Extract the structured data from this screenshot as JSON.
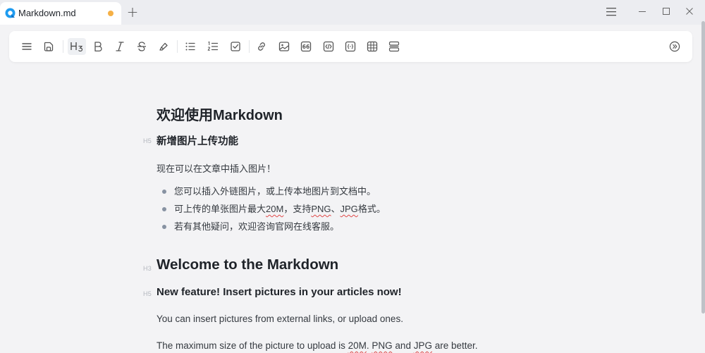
{
  "tab": {
    "title": "Markdown.md",
    "unsaved_color": "#f5b046"
  },
  "toolbar": {
    "buttons": [
      {
        "name": "menu-icon",
        "label": "menu"
      },
      {
        "name": "save-icon",
        "label": "save"
      },
      {
        "name": "heading-icon",
        "label": "H3",
        "active": true
      },
      {
        "name": "bold-icon",
        "label": "B"
      },
      {
        "name": "italic-icon",
        "label": "I"
      },
      {
        "name": "strikethrough-icon",
        "label": "S"
      },
      {
        "name": "highlight-icon",
        "label": "highlight"
      },
      {
        "name": "bullet-list-icon",
        "label": "bullet list"
      },
      {
        "name": "ordered-list-icon",
        "label": "ordered list"
      },
      {
        "name": "task-list-icon",
        "label": "task list"
      },
      {
        "name": "link-icon",
        "label": "link"
      },
      {
        "name": "image-icon",
        "label": "image"
      },
      {
        "name": "quote-icon",
        "label": "66"
      },
      {
        "name": "code-icon",
        "label": "code"
      },
      {
        "name": "code-block-icon",
        "label": "code block"
      },
      {
        "name": "table-icon",
        "label": "table"
      },
      {
        "name": "divider-icon",
        "label": "divider"
      },
      {
        "name": "expand-icon",
        "label": "more"
      }
    ]
  },
  "document": {
    "h1_cn": "欢迎使用Markdown",
    "h5_cn": "新增图片上传功能",
    "h5_cn_tag": "H5",
    "p_cn": "现在可以在文章中插入图片！",
    "bullets": [
      {
        "parts": [
          "您可以插入外链图片，或上传本地图片到文档中。"
        ]
      },
      {
        "parts": [
          "可上传的单张图片最大",
          "20M",
          "，支持",
          "PNG",
          "、",
          "JPG",
          "格式。"
        ]
      },
      {
        "parts": [
          "若有其他疑问，欢迎咨询官网在线客服。"
        ]
      }
    ],
    "h1_en": "Welcome to the Markdown",
    "h1_en_tag": "H3",
    "h5_en": "New feature! Insert pictures in your articles now!",
    "h5_en_tag": "H5",
    "p_en1": "You can insert pictures from external links, or upload ones.",
    "p_en2_a": "The maximum size of the picture to upload is ",
    "p_en2_b": "20M",
    "p_en2_c": ". ",
    "p_en2_d": "PNG",
    "p_en2_e": " and ",
    "p_en2_f": "JPG",
    "p_en2_g": " are better."
  }
}
